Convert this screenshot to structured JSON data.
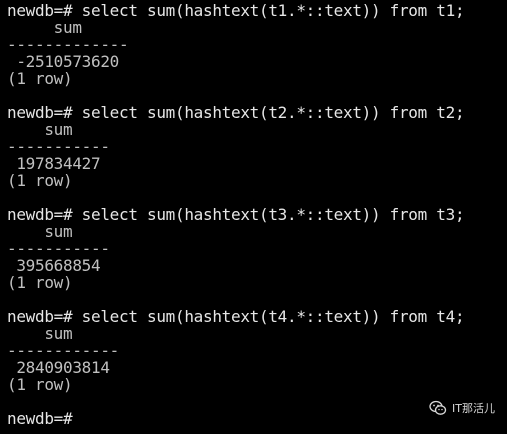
{
  "terminal": {
    "queries": [
      {
        "command": "newdb=# select sum(hashtext(t1.*::text)) from t1;",
        "header": "     sum",
        "separator": "-------------",
        "value": " -2510573620",
        "footer": "(1 row)"
      },
      {
        "command": "newdb=# select sum(hashtext(t2.*::text)) from t2;",
        "header": "    sum",
        "separator": "-----------",
        "value": " 197834427",
        "footer": "(1 row)"
      },
      {
        "command": "newdb=# select sum(hashtext(t3.*::text)) from t3;",
        "header": "    sum",
        "separator": "-----------",
        "value": " 395668854",
        "footer": "(1 row)"
      },
      {
        "command": "newdb=# select sum(hashtext(t4.*::text)) from t4;",
        "header": "    sum",
        "separator": "------------",
        "value": " 2840903814",
        "footer": "(1 row)"
      }
    ],
    "final_prompt": "newdb=# "
  },
  "watermark": {
    "text": "IT那活儿",
    "icon": "wechat-icon"
  }
}
